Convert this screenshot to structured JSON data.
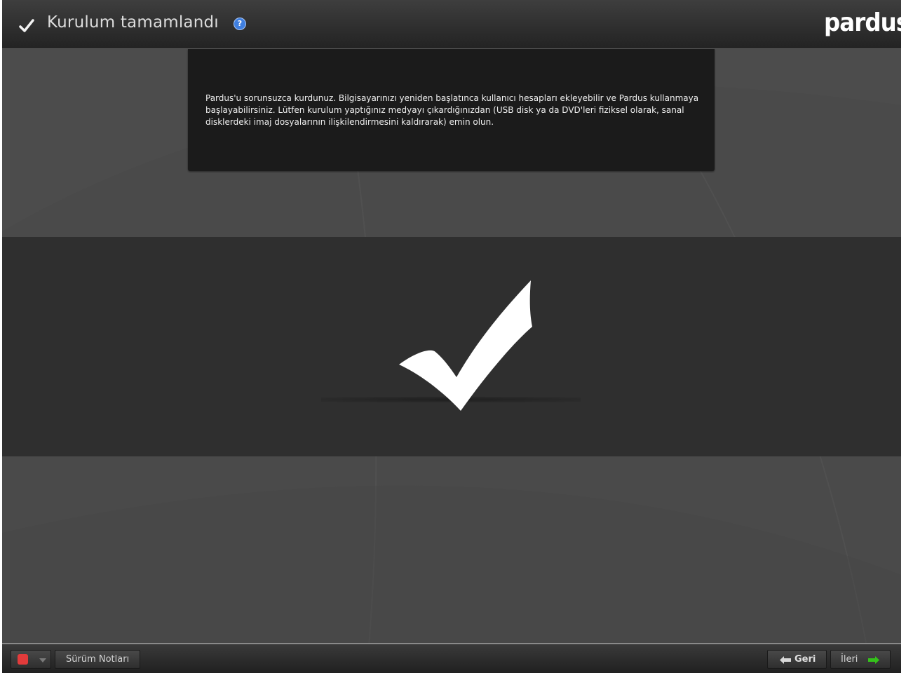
{
  "header": {
    "title": "Kurulum tamamlandı",
    "check_icon": "checkmark-icon",
    "help_icon": "help-icon",
    "help_glyph": "?",
    "brand": "pardus"
  },
  "info": {
    "text": "Pardus'u sorunsuzca kurdunuz. Bilgisayarınızı yeniden başlatınca kullanıcı hesapları ekleyebilir ve Pardus kullanmaya başlayabilirsiniz. Lütfen kurulum yaptığınız medyayı çıkardığınızdan (USB disk ya da DVD'leri fiziksel olarak, sanal disklerdeki imaj dosyalarının ilişkilendirmesini kaldırarak) emin olun."
  },
  "status": {
    "icon": "large-checkmark-icon"
  },
  "footer": {
    "power_icon": "power-icon",
    "release_notes_label": "Sürüm Notları",
    "back_label": "Geri",
    "next_label": "İleri"
  },
  "colors": {
    "background": "#4a4a4a",
    "panel": "#1b1b1b",
    "band": "#2f2f2f",
    "accent_blue": "#3f7fe0",
    "power_red": "#e23b3b",
    "arrow_green": "#34c21a"
  }
}
